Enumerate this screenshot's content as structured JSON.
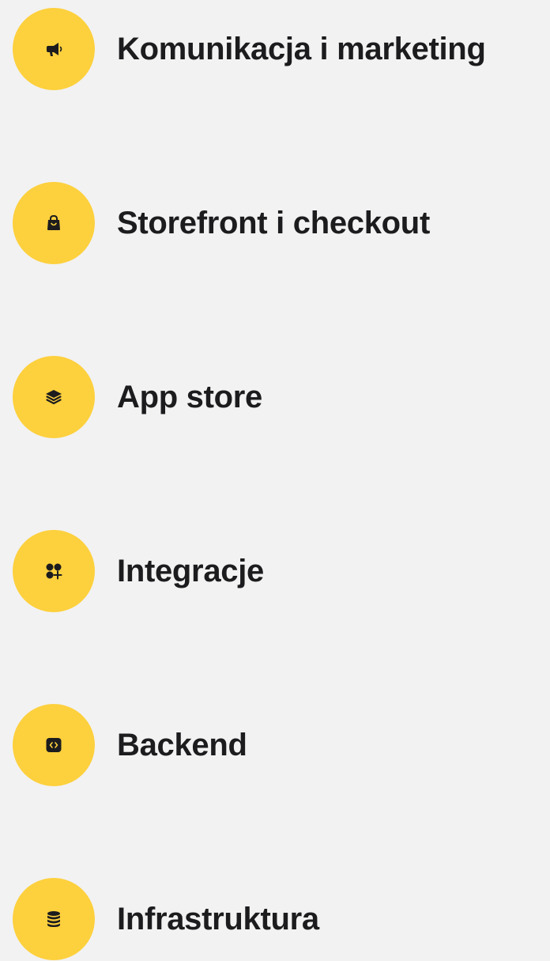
{
  "colors": {
    "background": "#f2f2f2",
    "icon_circle": "#fdd03d",
    "icon": "#1c1c1e",
    "text": "#1c1c1e"
  },
  "items": [
    {
      "label": "Komunikacja i marketing",
      "icon": "megaphone-icon"
    },
    {
      "label": "Storefront i checkout",
      "icon": "shopping-bag-icon"
    },
    {
      "label": "App store",
      "icon": "layers-icon"
    },
    {
      "label": "Integracje",
      "icon": "widgets-add-icon"
    },
    {
      "label": "Backend",
      "icon": "code-icon"
    },
    {
      "label": "Infrastruktura",
      "icon": "database-icon"
    }
  ]
}
